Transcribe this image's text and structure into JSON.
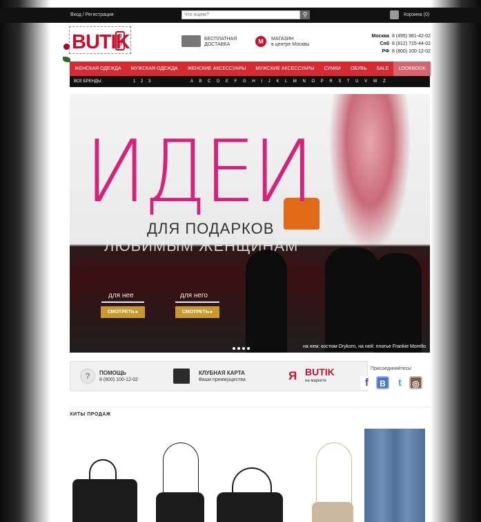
{
  "topbar": {
    "auth_label": "Вход / Регистрация",
    "search_placeholder": "Что ищем?",
    "cart_label": "Корзина (0)"
  },
  "logo": {
    "text": "BUTIK",
    "ru": "R U"
  },
  "features": {
    "delivery_line1": "БЕСПЛАТНАЯ",
    "delivery_line2": "ДОСТАВКА",
    "store_line1": "МАГАЗИН",
    "store_line2": "в центре Москвы",
    "metro_letter": "M"
  },
  "phones": [
    {
      "city": "Москва",
      "number": "8 (495) 981-42-02"
    },
    {
      "city": "Спб",
      "number": "8 (812) 715-44-02"
    },
    {
      "city": "РФ",
      "number": "8 (800) 100-12-02"
    }
  ],
  "nav": {
    "items": [
      "ЖЕНСКАЯ ОДЕЖДА",
      "МУЖСКАЯ ОДЕЖДА",
      "ЖЕНСКИЕ АКСЕССУАРЫ",
      "МУЖСКИЕ АКСЕССУАРЫ",
      "СУМКИ",
      "ОБУВЬ",
      "SALE",
      "LOOKBOOK"
    ]
  },
  "brands": {
    "label": "ВСЕ БРЕНДЫ:",
    "numbers": "1 2 3",
    "letters": "A B C D E F G H I J K L M N O P R S T U V W Z"
  },
  "hero": {
    "title": "ИДЕИ",
    "subtitle1": "ДЛЯ  ПОДАРКОВ",
    "subtitle2": "ЛЮБИМЫМ  ЖЕНЩИНАМ",
    "tag_her": "для нее",
    "tag_him": "для него",
    "cta_her": "СМОТРЕТЬ ▸",
    "cta_him": "СМОТРЕТЬ ▸",
    "caption": "на нем: костюм Drykorn, на ней: платье Frankie Morello"
  },
  "info": {
    "help_title": "ПОМОЩЬ",
    "help_phone": "8 (800) 100-12-02",
    "club_title": "КЛУБНАЯ КАРТА",
    "club_sub": "Ваши преимущества",
    "ya_letter": "Я",
    "market_logo": "BUTIK",
    "market_sub": "на маркете"
  },
  "social": {
    "title": "Присоединяйтесь!",
    "icons": [
      "f",
      "B",
      "t",
      "◎"
    ]
  },
  "section": {
    "hits_title": "ХИТЫ ПРОДАЖ"
  }
}
